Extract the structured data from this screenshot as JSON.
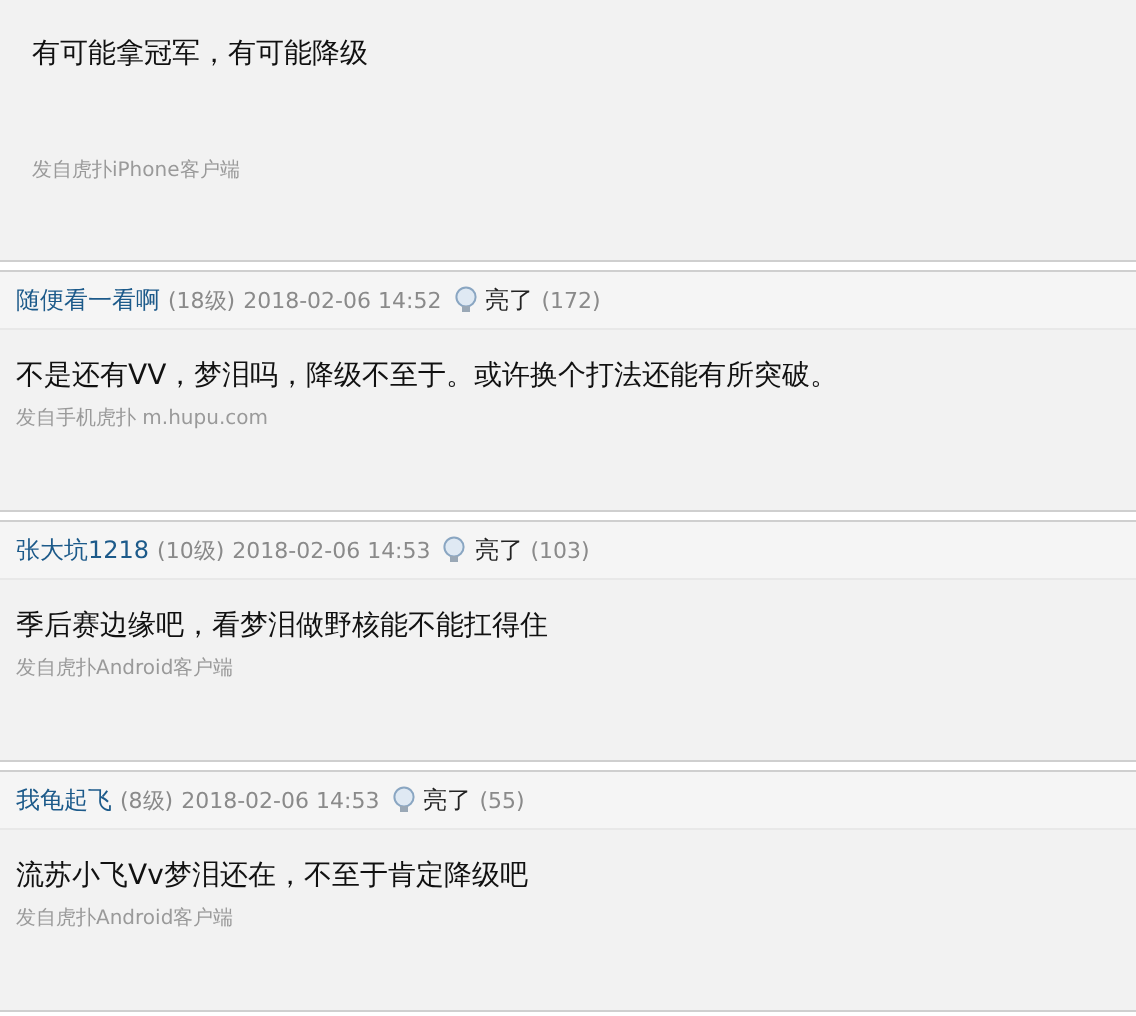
{
  "first_post": {
    "content": "有可能拿冠军，有可能降级",
    "source": "发自虎扑iPhone客户端"
  },
  "replies": [
    {
      "author": "随便看一看啊",
      "level": "(18级)",
      "time": "2018-02-06 14:52",
      "light_label": "亮了",
      "light_count": "(172)",
      "content": "不是还有VV，梦泪吗，降级不至于。或许换个打法还能有所突破。",
      "source": "发自手机虎扑 m.hupu.com"
    },
    {
      "author": "张大坑1218",
      "level": "(10级)",
      "time": "2018-02-06 14:53",
      "light_label": "亮了",
      "light_count": "(103)",
      "content": "季后赛边缘吧，看梦泪做野核能不能扛得住",
      "source": "发自虎扑Android客户端"
    },
    {
      "author": "我龟起飞",
      "level": "(8级)",
      "time": "2018-02-06 14:53",
      "light_label": "亮了",
      "light_count": "(55)",
      "content": "流苏小飞Vv梦泪还在，不至于肯定降级吧",
      "source": "发自虎扑Android客户端"
    }
  ]
}
